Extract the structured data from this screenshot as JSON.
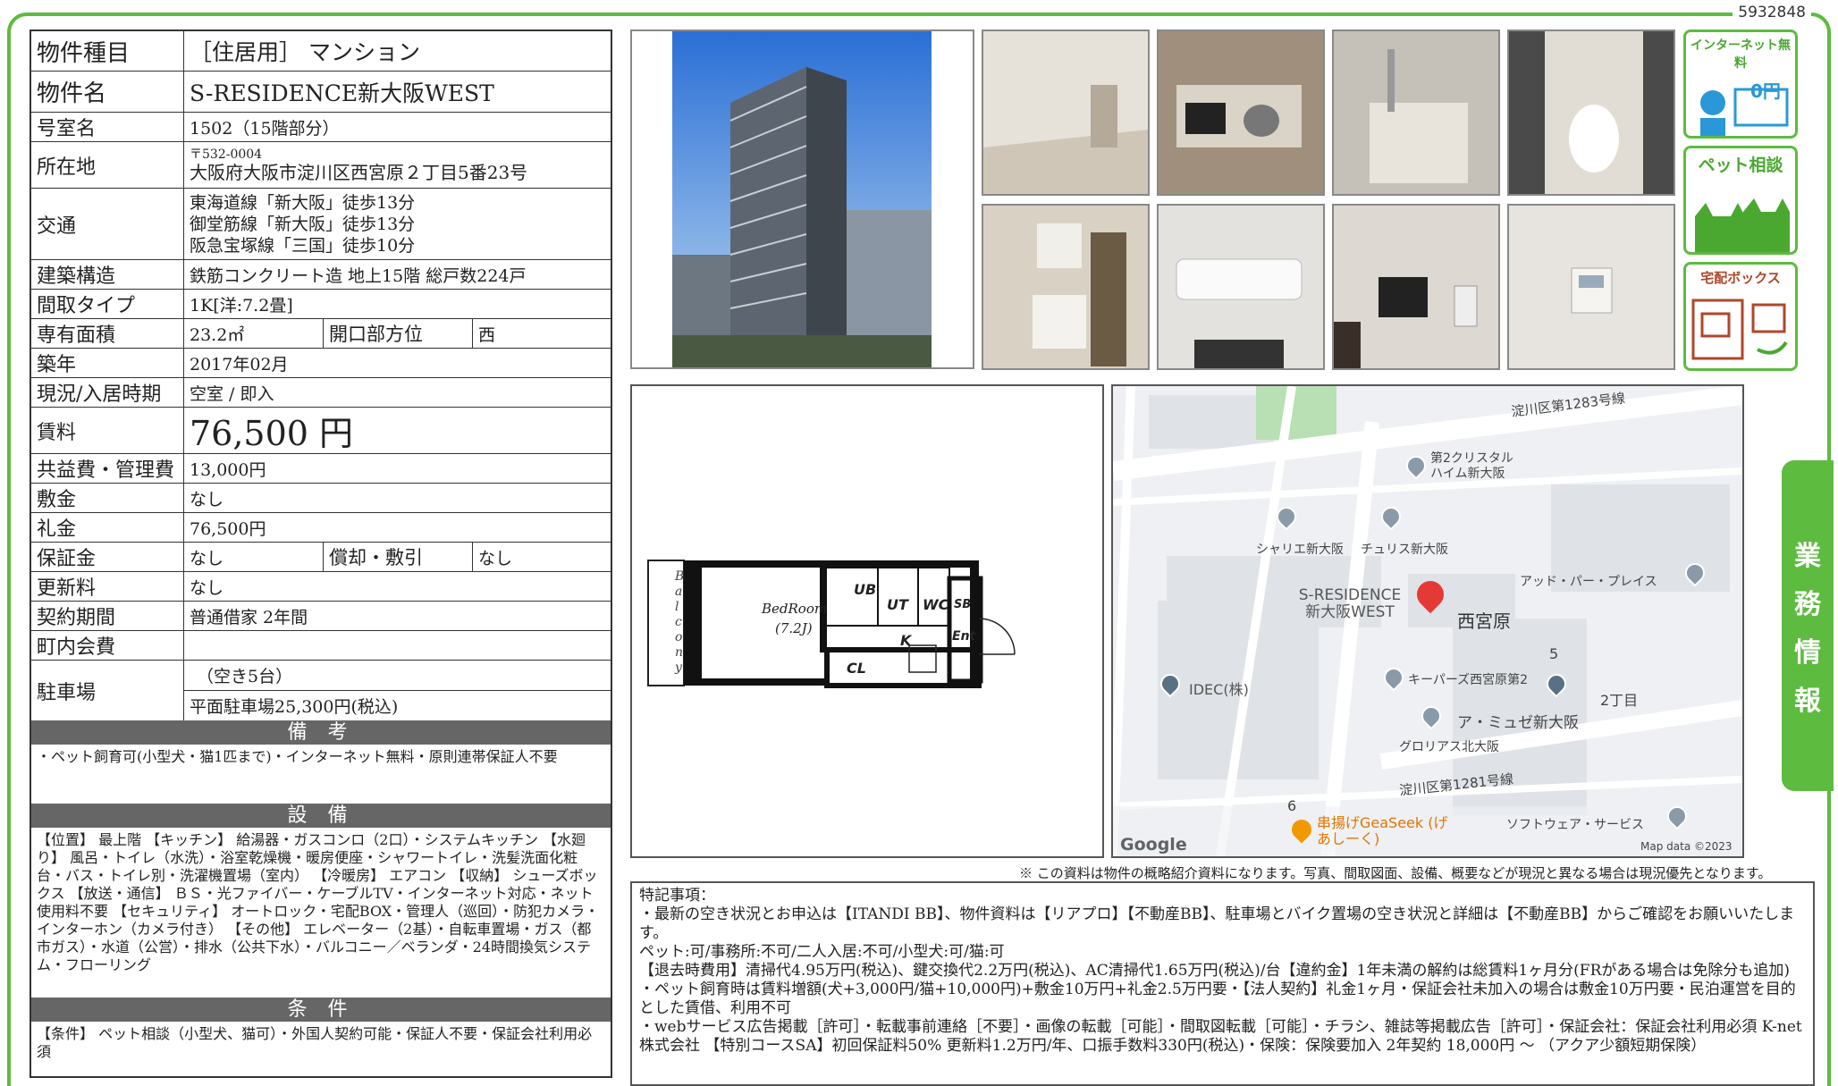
{
  "doc_id": "5932848",
  "property": {
    "type_label": "物件種目",
    "type_value": "［住居用］ マンション",
    "name_label": "物件名",
    "name_value": "S-RESIDENCE新大阪WEST",
    "room_label": "号室名",
    "room_value": "1502（15階部分）",
    "address_label": "所在地",
    "postal": "〒532-0004",
    "address": "大阪府大阪市淀川区西宮原２丁目5番23号",
    "access_label": "交通",
    "access": [
      "東海道線「新大阪」徒歩13分",
      "御堂筋線「新大阪」徒歩13分",
      "阪急宝塚線「三国」徒歩10分"
    ],
    "structure_label": "建築構造",
    "structure_value": "鉄筋コンクリート造 地上15階 総戸数224戸",
    "layout_label": "間取タイプ",
    "layout_value": "1K[洋:7.2畳]",
    "area_label": "専有面積",
    "area_value": "23.2㎡",
    "facing_label": "開口部方位",
    "facing_value": "西",
    "built_label": "築年",
    "built_value": "2017年02月",
    "status_label": "現況/入居時期",
    "status_value": "空室 / 即入",
    "rent_label": "賃料",
    "rent_value": "76,500 円",
    "mgmt_label": "共益費・管理費",
    "mgmt_value": "13,000円",
    "deposit_label": "敷金",
    "deposit_value": "なし",
    "key_label": "礼金",
    "key_value": "76,500円",
    "guarantee_label": "保証金",
    "guarantee_value": "なし",
    "amort_label": "償却・敷引",
    "amort_value": "なし",
    "renew_label": "更新料",
    "renew_value": "なし",
    "contract_label": "契約期間",
    "contract_value": "普通借家 2年間",
    "town_label": "町内会費",
    "town_value": "",
    "parking_label": "駐車場",
    "parking_avail": "（空き5台）",
    "parking_value": "平面駐車場25,300円(税込)"
  },
  "sections": {
    "notes_title": "備 考",
    "notes_text": "・ペット飼育可(小型犬・猫1匹まで)・インターネット無料・原則連帯保証人不要",
    "equip_title": "設 備",
    "equip_text": "【位置】 最上階 【キッチン】 給湯器・ガスコンロ（2口）・システムキッチン 【水廻り】 風呂・トイレ（水洗）・浴室乾燥機・暖房便座・シャワートイレ・洗髪洗面化粧台・バス・トイレ別・洗濯機置場（室内） 【冷暖房】 エアコン 【収納】 シューズボックス 【放送・通信】 ＢＳ・光ファイバー・ケーブルTV・インターネット対応・ネット使用料不要 【セキュリティ】 オートロック・宅配BOX・管理人（巡回）・防犯カメラ・インターホン（カメラ付き） 【その他】 エレベーター（2基）・自転車置場・ガス（都市ガス）・水道（公営）・排水（公共下水）・バルコニー／ベランダ・24時間換気システム・フローリング",
    "cond_title": "条 件",
    "cond_text": "【条件】 ペット相談（小型犬、猫可）・外国人契約可能・保証人不要・保証会社利用必須"
  },
  "badges": {
    "internet": "インターネット無料",
    "internet_sub": "0円",
    "pet": "ペット相談",
    "delivery": "宅配ボックス"
  },
  "floorplan": {
    "balcony": "Balcony",
    "bedroom": "BedRoom",
    "bedroom_size": "(7.2J)",
    "ub": "UB",
    "ut": "UT",
    "wc": "WC",
    "sb": "SB",
    "k": "K",
    "ent": "Ent",
    "cl": "CL"
  },
  "map": {
    "road1": "淀川区第1283号線",
    "road2": "淀川区第1281号線",
    "p1": "第2クリスタル ハイム新大阪",
    "p2": "シャリエ新大阪",
    "p3": "チュリス新大阪",
    "p4": "アッド・パー・プレイス",
    "p5": "S-RESIDENCE 新大阪WEST",
    "p6": "西宮原",
    "p7": "IDEC(株)",
    "p8": "キーパーズ西宮原第2",
    "p9": "2丁目",
    "p10": "ア・ミュゼ新大阪",
    "p11": "グロリアス北大阪",
    "p12": "串揚げGeaSeek (げあしーく)",
    "p13": "ソフトウェア・サービス",
    "n5": "5",
    "n6": "6",
    "google": "Google",
    "mapdata": "Map data ©2023"
  },
  "note": "※ この資料は物件の概略紹介資料になります。写真、間取図面、設備、概要などが現況と異なる場合は現況優先となります。",
  "special": {
    "title": "特記事項：",
    "lines": [
      "・最新の空き状況とお申込は【ITANDI BB】、物件資料は【リアプロ】【不動産BB】、駐車場とバイク置場の空き状況と詳細は【不動産BB】からご確認をお願いいたします。",
      "ペット:可/事務所:不可/二人入居:不可/小型犬:可/猫:可",
      "【退去時費用】清掃代4.95万円(税込)、鍵交換代2.2万円(税込)、AC清掃代1.65万円(税込)/台【違約金】1年未満の解約は総賃料1ヶ月分(FRがある場合は免除分も追加) ・ペット飼育時は賃料増額(犬+3,000円/猫+10,000円)+敷金10万円+礼金2.5万円要・【法人契約】礼金1ヶ月・保証会社未加入の場合は敷金10万円要・民泊運営を目的とした賃借、利用不可",
      "・webサービス広告掲載［許可］・転載事前連絡［不要］・画像の転載［可能］・間取図転載［可能］・チラシ、雑誌等掲載広告［許可］・保証会社：保証会社利用必須 K-net株式会社 【特別コースSA】初回保証料50% 更新料1.2万円/年、口振手数料330円(税込)・保険：保険要加入 2年契約 18,000円 〜 （アクア少額短期保険）"
    ]
  },
  "side_tab": [
    "業",
    "務",
    "情",
    "報"
  ],
  "colors": {
    "accent": "#5dbb3f",
    "section": "#666666"
  }
}
